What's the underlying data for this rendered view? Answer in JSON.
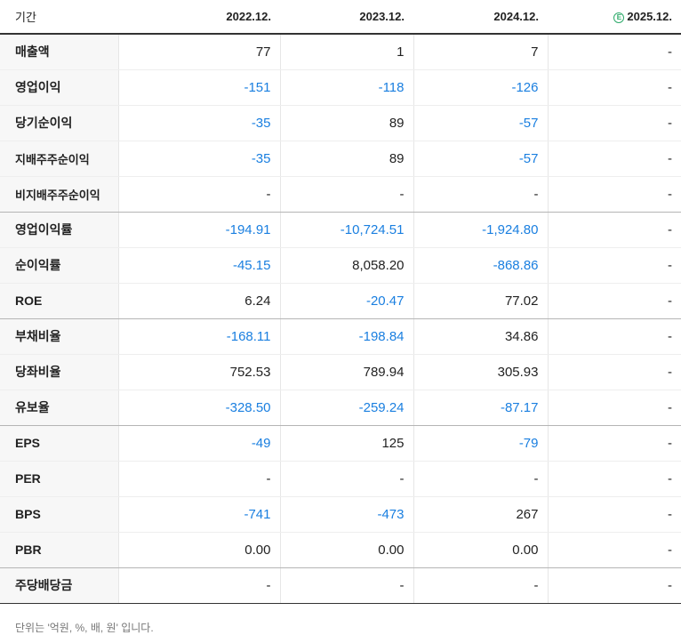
{
  "header": {
    "label": "기간",
    "periods": [
      "2022.12.",
      "2023.12.",
      "2024.12.",
      "2025.12."
    ],
    "estimate_badge": "E"
  },
  "colors": {
    "negative": "#1a7fe0",
    "estimate_badge": "#2eaa6a"
  },
  "rows": [
    {
      "label": "매출액",
      "values": [
        "77",
        "1",
        "7",
        "-"
      ]
    },
    {
      "label": "영업이익",
      "values": [
        "-151",
        "-118",
        "-126",
        "-"
      ]
    },
    {
      "label": "당기순이익",
      "values": [
        "-35",
        "89",
        "-57",
        "-"
      ]
    },
    {
      "label": "지배주주순이익",
      "values": [
        "-35",
        "89",
        "-57",
        "-"
      ]
    },
    {
      "label": "비지배주주순이익",
      "values": [
        "-",
        "-",
        "-",
        "-"
      ]
    },
    {
      "label": "영업이익률",
      "values": [
        "-194.91",
        "-10,724.51",
        "-1,924.80",
        "-"
      ]
    },
    {
      "label": "순이익률",
      "values": [
        "-45.15",
        "8,058.20",
        "-868.86",
        "-"
      ]
    },
    {
      "label": "ROE",
      "values": [
        "6.24",
        "-20.47",
        "77.02",
        "-"
      ]
    },
    {
      "label": "부채비율",
      "values": [
        "-168.11",
        "-198.84",
        "34.86",
        "-"
      ]
    },
    {
      "label": "당좌비율",
      "values": [
        "752.53",
        "789.94",
        "305.93",
        "-"
      ]
    },
    {
      "label": "유보율",
      "values": [
        "-328.50",
        "-259.24",
        "-87.17",
        "-"
      ]
    },
    {
      "label": "EPS",
      "values": [
        "-49",
        "125",
        "-79",
        "-"
      ]
    },
    {
      "label": "PER",
      "values": [
        "-",
        "-",
        "-",
        "-"
      ]
    },
    {
      "label": "BPS",
      "values": [
        "-741",
        "-473",
        "267",
        "-"
      ]
    },
    {
      "label": "PBR",
      "values": [
        "0.00",
        "0.00",
        "0.00",
        "-"
      ]
    },
    {
      "label": "주당배당금",
      "values": [
        "-",
        "-",
        "-",
        "-"
      ]
    }
  ],
  "footnote": "단위는 '억원, %, 배, 원' 입니다."
}
